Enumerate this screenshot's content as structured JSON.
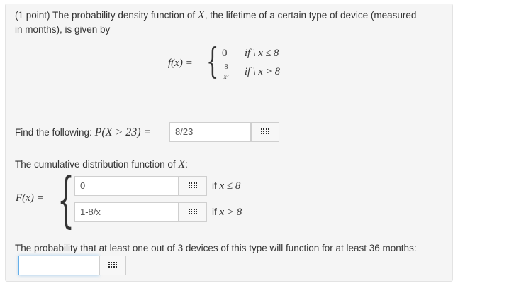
{
  "problem": {
    "intro_line1": "(1 point) The probability density function of",
    "var_X": "X",
    "intro_line1b": ", the lifetime of a certain type of device (measured",
    "intro_line2": "in months), is given by",
    "pdf": {
      "lhs": "f(x) =",
      "case1_value": "0",
      "case1_cond": "if \\ x ≤ 8",
      "case2_num": "8",
      "case2_den": "x²",
      "case2_cond": "if \\ x > 8"
    }
  },
  "part1": {
    "prompt": "Find the following:",
    "expr": "P(X > 23) =",
    "answer_value": "8/23"
  },
  "part2": {
    "prompt": "The cumulative distribution function of",
    "var": "X",
    "colon": ":",
    "lhs": "F(x) =",
    "row1_value": "0",
    "row1_cond_prefix": "if",
    "row1_cond_math": "x ≤ 8",
    "row2_value": "1-8/x",
    "row2_cond_prefix": "if",
    "row2_cond_math": "x > 8"
  },
  "part3": {
    "prompt": "The probability that at least one out of 3 devices of this type will function for at least 36 months:",
    "answer_value": ""
  },
  "icons": {
    "answer_preview": "grid-icon"
  },
  "colors": {
    "card_bg": "#f5f5f5",
    "focus_border": "#66afe9"
  }
}
